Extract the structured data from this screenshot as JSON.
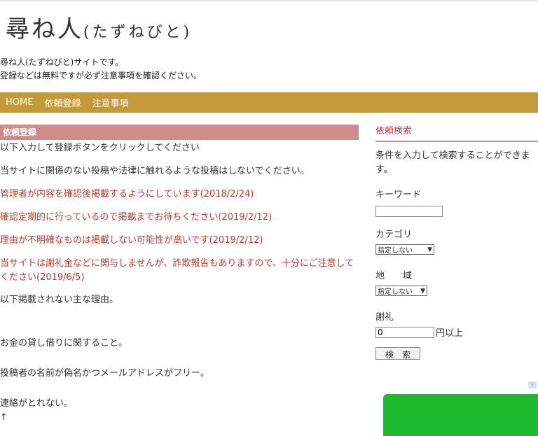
{
  "header": {
    "site_title_main": "尋ね人",
    "site_title_ruby": "(たずねびと)"
  },
  "intro": {
    "line1": "尋ね人(たずねびと)サイトです。",
    "line2": "登録などは無料ですが必ず注意事項を確認ください。"
  },
  "nav": {
    "items": [
      "HOME",
      "依頼登録",
      "注意事項"
    ]
  },
  "main": {
    "heading": "依頼登録",
    "lines": [
      "以下入力して登録ボタンをクリックしてください",
      "当サイトに関係のない投稿や法律に触れるような投稿はしないでください。",
      "管理者が内容を確認後掲載するようにしています(2018/2/24)",
      "確認定期的に行っているので掲載までお待ちください(2019/2/12)",
      "理由が不明確なものは掲載しない可能性が高いです(2019/2/12)",
      "当サイトは謝礼金などに関与しませんが、詐欺報告もありますので、十分にご注意して",
      "ください(2019/6/5)",
      "以下掲載されない主な理由。",
      "お金の貸し借りに関すること。",
      "投稿者の名前が偽名かつメールアドレスがフリー。",
      "連絡がとれない。",
      "↑"
    ]
  },
  "sidebar": {
    "heading": "依頼検索",
    "desc_line1": "条件を入力して検索することができま",
    "desc_line2": "す。",
    "keyword_label": "キーワード",
    "keyword_value": "",
    "category_label": "カテゴリ",
    "category_selected": "指定しない",
    "region_label": "地　　域",
    "region_selected": "指定しない",
    "reward_label": "謝礼",
    "reward_value": "0",
    "reward_suffix": "円以上",
    "search_button": "検　索"
  },
  "colors": {
    "nav_bg": "#c29a3a",
    "heading_bg": "#cf8b8b",
    "notice_red": "#c0392b",
    "ad_green": "#1cba2c"
  }
}
